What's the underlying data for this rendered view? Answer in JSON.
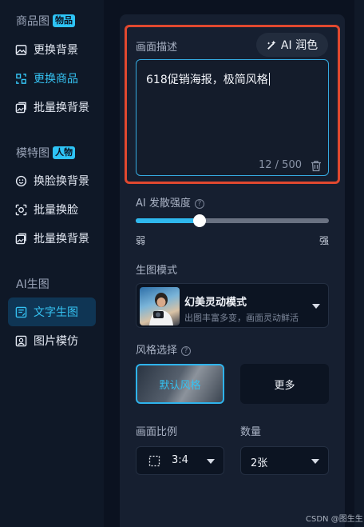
{
  "sidebar": {
    "sections": [
      {
        "title": "商品图",
        "badge": "物品"
      },
      {
        "title": "模特图",
        "badge": "人物"
      },
      {
        "title": "AI生图"
      }
    ],
    "items": [
      {
        "label": "更换背景",
        "icon": "image-icon"
      },
      {
        "label": "更换商品",
        "icon": "product-swap-icon"
      },
      {
        "label": "批量换背景",
        "icon": "batch-image-icon"
      },
      {
        "label": "换脸换背景",
        "icon": "face-swap-icon"
      },
      {
        "label": "批量换脸",
        "icon": "face-scan-icon"
      },
      {
        "label": "批量换背景",
        "icon": "batch-image-icon"
      },
      {
        "label": "文字生图",
        "icon": "text-image-icon"
      },
      {
        "label": "图片模仿",
        "icon": "image-mimic-icon"
      }
    ]
  },
  "description": {
    "label": "画面描述",
    "ai_button": "AI 润色",
    "value": "618促销海报，极简风格",
    "char_count": "12 / 500"
  },
  "strength": {
    "label": "AI 发散强度",
    "min_label": "弱",
    "max_label": "强",
    "value": 0.33
  },
  "mode": {
    "label": "生图模式",
    "selected": "幻美灵动模式",
    "description": "出图丰富多变，画面灵动鲜活"
  },
  "style": {
    "label": "风格选择",
    "selected": "默认风格",
    "more_label": "更多"
  },
  "ratio": {
    "label": "画面比例",
    "value": "3:4"
  },
  "count": {
    "label": "数量",
    "value": "2张"
  },
  "watermark": "CSDN @图生生",
  "colors": {
    "accent": "#2ec3f5",
    "highlight": "#e0482f",
    "selected_bg": "#0f3554"
  }
}
